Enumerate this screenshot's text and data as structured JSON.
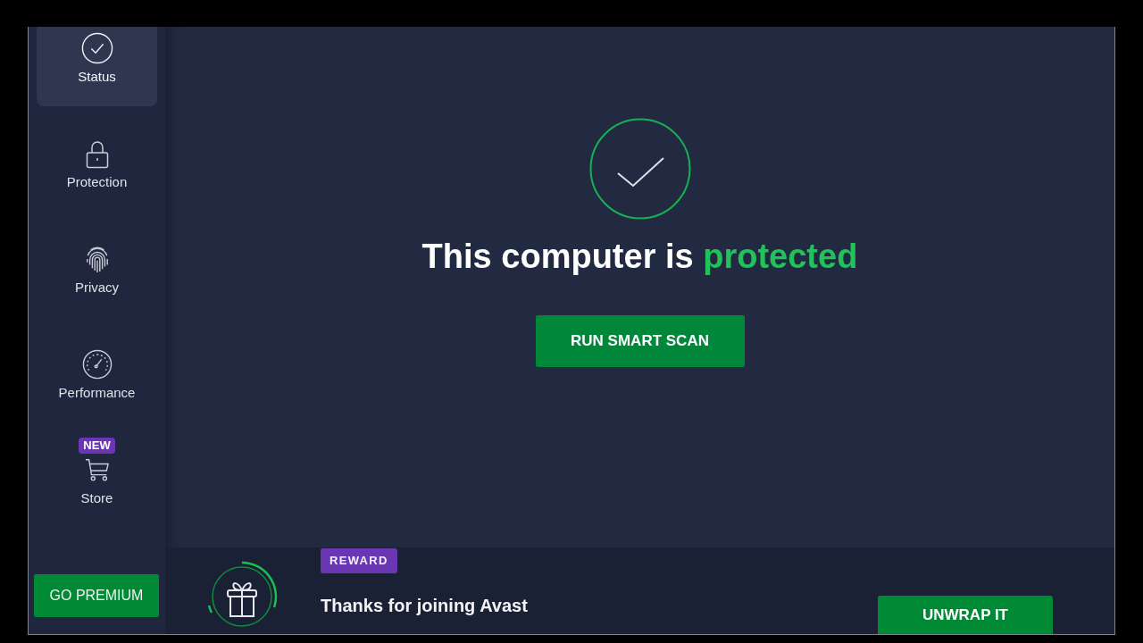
{
  "sidebar": {
    "items": [
      {
        "label": "Status",
        "selected": true
      },
      {
        "label": "Protection",
        "selected": false
      },
      {
        "label": "Privacy",
        "selected": false
      },
      {
        "label": "Performance",
        "selected": false
      },
      {
        "label": "Store",
        "selected": false,
        "badge": "NEW"
      }
    ],
    "premium_button": "GO PREMIUM"
  },
  "status": {
    "headline": {
      "text": "This computer is",
      "highlight": "protected"
    },
    "scan_button": "RUN SMART SCAN"
  },
  "reward": {
    "badge": "REWARD",
    "title": "Thanks for joining Avast",
    "button": "UNWRAP IT"
  }
}
